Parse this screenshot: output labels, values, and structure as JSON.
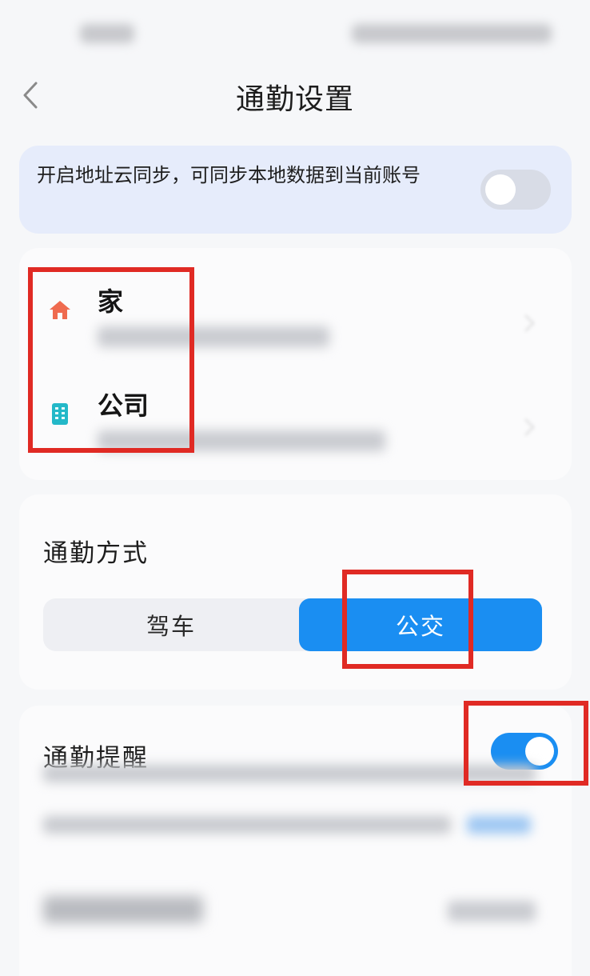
{
  "header": {
    "title": "通勤设置"
  },
  "sync_banner": {
    "text": "开启地址云同步，可同步本地数据到当前账号",
    "enabled": false
  },
  "addresses": [
    {
      "label": "家",
      "icon": "home-icon"
    },
    {
      "label": "公司",
      "icon": "building-icon"
    }
  ],
  "commute_mode": {
    "title": "通勤方式",
    "options": [
      "驾车",
      "公交"
    ],
    "selected": "公交"
  },
  "commute_reminder": {
    "title": "通勤提醒",
    "enabled": true
  },
  "colors": {
    "accent": "#1a8ef2",
    "annotation": "#e02a24",
    "banner": "#e6ecfb"
  }
}
